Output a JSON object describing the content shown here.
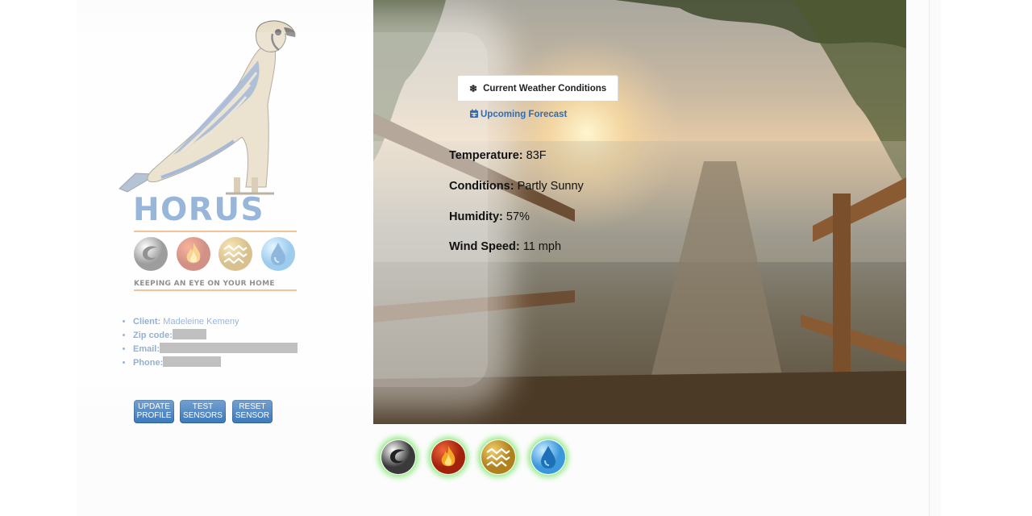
{
  "brand": {
    "name": "HORUS",
    "tagline": "KEEPING AN EYE ON YOUR HOME",
    "colors": {
      "blue": "#2f6db5",
      "orange": "#e8842c"
    },
    "icons": [
      "wind-sensor-icon",
      "fire-sensor-icon",
      "heat-sensor-icon",
      "water-sensor-icon"
    ]
  },
  "client": {
    "client_label": "Client:",
    "client_value": "Madeleine Kemeny",
    "zip_label": "Zip code:",
    "email_label": "Email:",
    "phone_label": "Phone:"
  },
  "actions": {
    "update_label": "UPDATE PROFILE",
    "test_label": "TEST SENSORS",
    "reset_label": "RESET SENSOR"
  },
  "weather": {
    "tab_current": "Current Weather Conditions",
    "tab_forecast": "Upcoming Forecast",
    "temperature_label": "Temperature:",
    "temperature_value": "83F",
    "conditions_label": "Conditions:",
    "conditions_value": "Partly Sunny",
    "humidity_label": "Humidity:",
    "humidity_value": "57%",
    "wind_label": "Wind Speed:",
    "wind_value": "11 mph"
  },
  "sensors": {
    "glow_color": "#6ee65a",
    "items": [
      "wind-sensor-icon",
      "fire-sensor-icon",
      "heat-sensor-icon",
      "water-sensor-icon"
    ]
  }
}
